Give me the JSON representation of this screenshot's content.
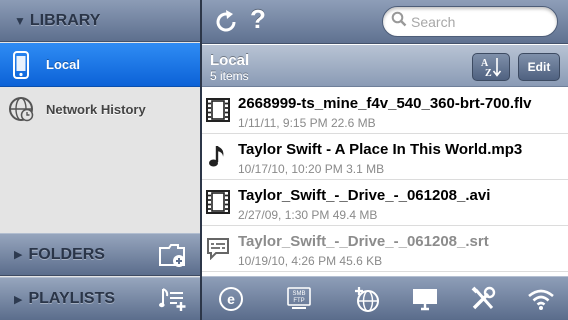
{
  "sidebar": {
    "header": {
      "title": "LIBRARY"
    },
    "items": [
      {
        "label": "Local",
        "icon": "phone-icon",
        "selected": true
      },
      {
        "label": "Network History",
        "icon": "globe-clock-icon",
        "selected": false
      }
    ],
    "folders": {
      "label": "FOLDERS",
      "action_icon": "add-folder-icon"
    },
    "playlists": {
      "label": "PLAYLISTS",
      "action_icon": "add-playlist-icon"
    }
  },
  "toolbar": {
    "refresh_icon": "refresh-icon",
    "help_label": "?",
    "search": {
      "placeholder": "Search",
      "value": ""
    }
  },
  "list_header": {
    "title": "Local",
    "subtitle": "5 items",
    "sort_label": "A Z",
    "edit_label": "Edit"
  },
  "files": [
    {
      "name": "2668999-ts_mine_f4v_540_360-brt-700.flv",
      "meta": "1/11/11, 9:15 PM 22.6 MB",
      "icon": "film-icon"
    },
    {
      "name": "Taylor Swift - A Place In This World.mp3",
      "meta": "10/17/10, 10:20 PM 3.1 MB",
      "icon": "music-note-icon"
    },
    {
      "name": "Taylor_Swift_-_Drive_-_061208_.avi",
      "meta": "2/27/09, 1:30 PM 49.4 MB",
      "icon": "film-icon"
    },
    {
      "name": "Taylor_Swift_-_Drive_-_061208_.srt",
      "meta": "10/19/10, 4:26 PM 45.6 KB",
      "icon": "subtitle-icon"
    }
  ],
  "bottombar": {
    "icons": [
      "browser-icon",
      "smb-ftp-icon",
      "add-network-icon",
      "monitor-icon",
      "tools-icon",
      "wifi-icon"
    ],
    "smb_label_top": "SMB",
    "smb_label_bottom": "FTP"
  },
  "colors": {
    "selection_blue": "#1a73e8",
    "bar_slate": "#6f809e"
  }
}
